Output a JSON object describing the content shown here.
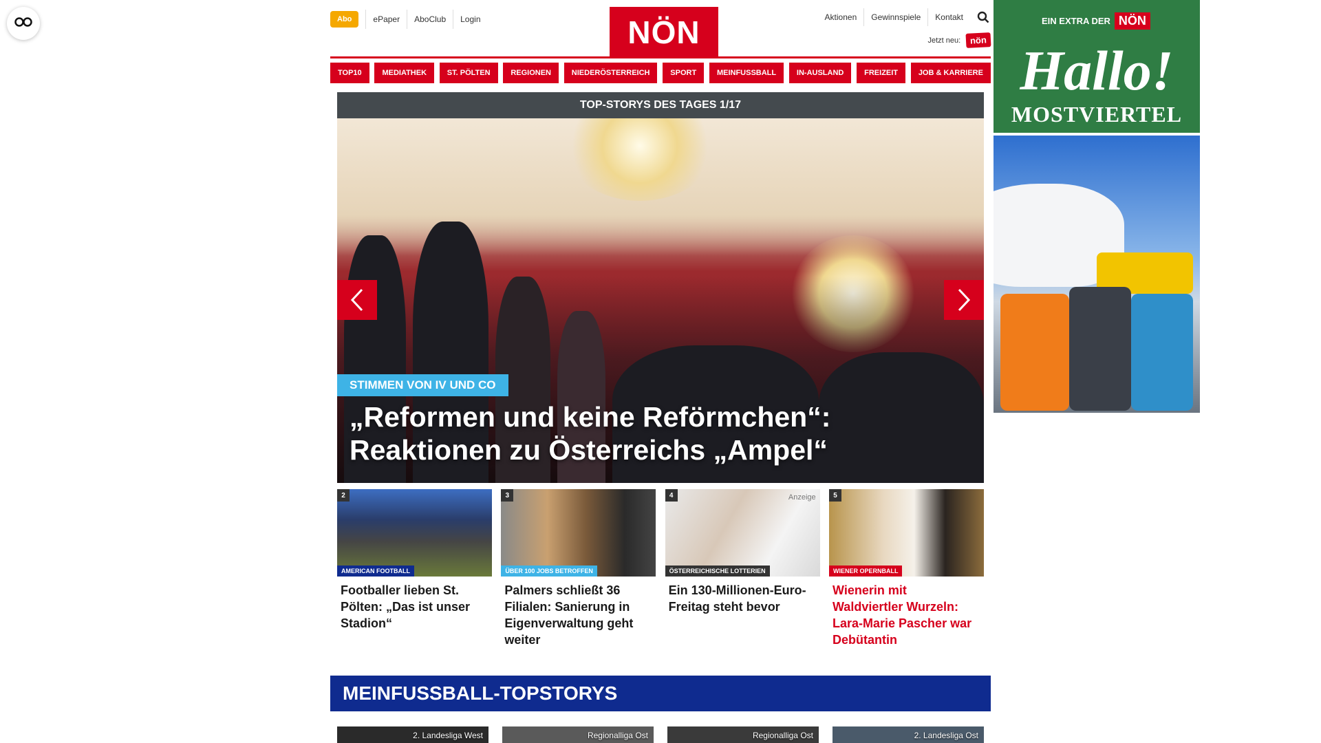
{
  "accessibility": {
    "icon": "glasses-icon"
  },
  "header": {
    "abo_label": "Abo",
    "top_links": [
      "ePaper",
      "AboClub",
      "Login"
    ],
    "logo_text": "NÖN",
    "right_links": [
      "Aktionen",
      "Gewinnspiele",
      "Kontakt"
    ],
    "search_icon": "search-icon",
    "jetzt_label": "Jetzt neu:",
    "jetzt_badge": "nön"
  },
  "nav": {
    "items": [
      "TOP10",
      "MEDIATHEK",
      "ST. PÖLTEN",
      "REGIONEN",
      "NIEDERÖSTERREICH",
      "SPORT",
      "MEINFUSSBALL",
      "IN-AUSLAND",
      "FREIZEIT",
      "JOB & KARRIERE"
    ]
  },
  "slider": {
    "heading": "TOP-STORYS DES TAGES 1/17",
    "kicker": "STIMMEN VON IV UND CO",
    "headline": "„Reformen und keine Reförmchen“: Reaktionen zu Österreichs „Ampel“"
  },
  "teasers": [
    {
      "num": "2",
      "kicker": "AMERICAN FOOTBALL",
      "kicker_color": "#0f2b8f",
      "title": "Footballer lieben St. Pölten: „Das ist unser Stadion“",
      "red": false
    },
    {
      "num": "3",
      "kicker": "ÜBER 100 JOBS BETROFFEN",
      "kicker_color": "#3eb3e6",
      "title": "Palmers schließt 36 Filialen: Sanierung in Eigenverwaltung geht weiter",
      "red": false
    },
    {
      "num": "4",
      "kicker": "ÖSTERREICHISCHE LOTTERIEN",
      "kicker_color": "#333333",
      "title": "Ein 130-Millionen-Euro-Freitag steht bevor",
      "red": false,
      "anzeige": "Anzeige"
    },
    {
      "num": "5",
      "kicker": "WIENER OPERNBALL",
      "kicker_color": "#d6001c",
      "title": "Wienerin mit Waldviertler Wurzeln: Lara-Marie Pascher war Debütantin",
      "red": true
    }
  ],
  "section": {
    "title": "MEINFUSSBALL-TOPSTORYS",
    "cards": [
      "2. Landesliga West",
      "Regionalliga Ost",
      "Regionalliga Ost",
      "2. Landesliga Ost"
    ]
  },
  "ad": {
    "extra_label": "EIN EXTRA DER",
    "extra_logo": "NÖN",
    "hallo": "Hallo!",
    "region": "MOSTVIERTEL"
  },
  "colors": {
    "brand_red": "#d6001c",
    "abo_orange": "#f5a800",
    "section_blue": "#0f2b8f",
    "kicker_blue": "#3eb3e6",
    "ad_green": "#2f7d44"
  }
}
